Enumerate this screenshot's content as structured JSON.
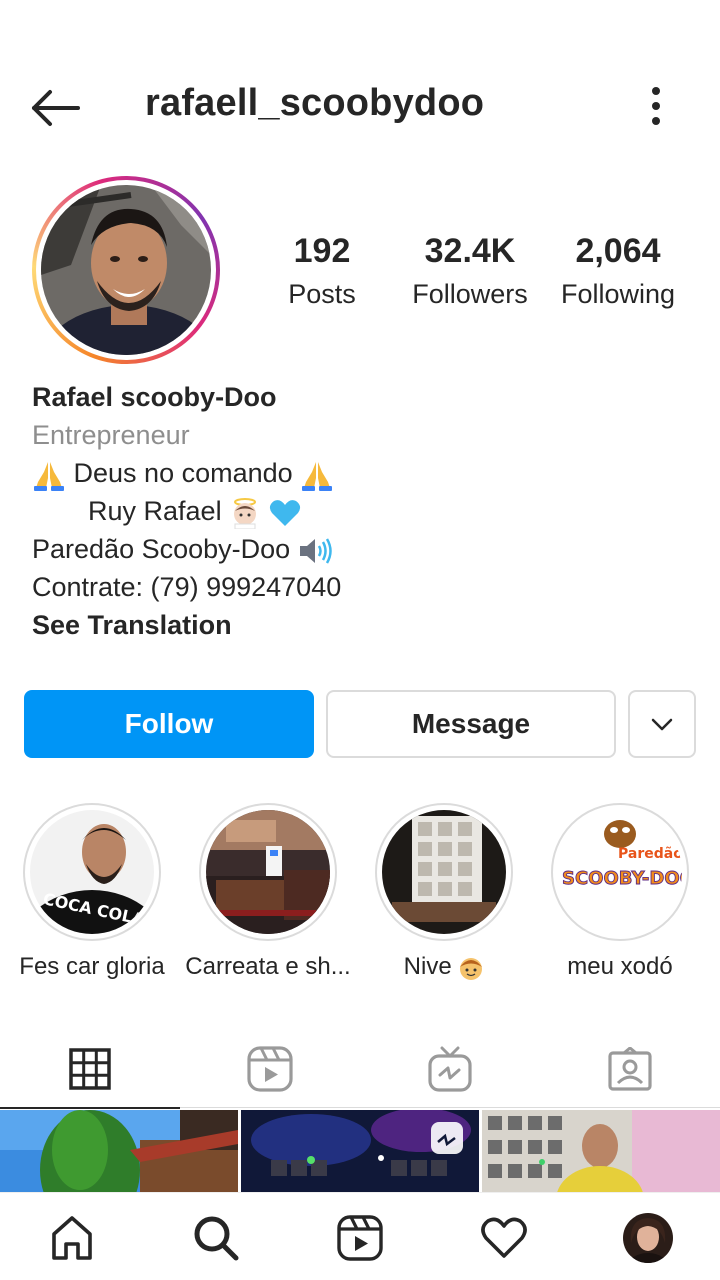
{
  "header": {
    "username": "rafaell_scoobydoo",
    "back_icon": "arrow-left-icon",
    "more_icon": "more-vertical-icon"
  },
  "stats": {
    "posts_count": "192",
    "posts_label": "Posts",
    "followers_count": "32.4K",
    "followers_label": "Followers",
    "following_count": "2,064",
    "following_label": "Following"
  },
  "bio": {
    "name": "Rafael scooby-Doo",
    "category": "Entrepreneur",
    "line1": "Deus no comando",
    "line2": "Ruy Rafael",
    "line3": "Paredão Scooby-Doo",
    "line4": "Contrate: (79) 999247040",
    "see_translation": "See Translation"
  },
  "actions": {
    "follow_label": "Follow",
    "message_label": "Message",
    "dropdown_icon": "chevron-down-icon"
  },
  "highlights": [
    {
      "label": "Fes car gloria"
    },
    {
      "label": "Carreata e sh..."
    },
    {
      "label": "Nive"
    },
    {
      "label": "meu xodó"
    }
  ],
  "highlight_art_text": {
    "cocacola": "COCA COLA",
    "paredao": "Paredão",
    "scooby": "SCOOBY-DOO!"
  },
  "tabs": [
    {
      "icon": "grid-icon",
      "active": true
    },
    {
      "icon": "reels-icon",
      "active": false
    },
    {
      "icon": "igtv-icon",
      "active": false
    },
    {
      "icon": "tagged-icon",
      "active": false
    }
  ],
  "bottom_nav": [
    {
      "icon": "home-icon"
    },
    {
      "icon": "search-icon"
    },
    {
      "icon": "reels-icon"
    },
    {
      "icon": "heart-icon"
    },
    {
      "icon": "profile-avatar"
    }
  ],
  "colors": {
    "primary_blue": "#0095f6",
    "text": "#262626",
    "secondary_text": "#8e8e8e",
    "border": "#dbdbdb"
  }
}
